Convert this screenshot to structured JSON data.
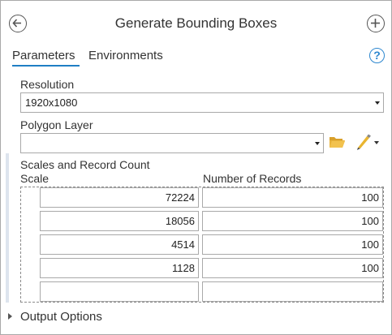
{
  "header": {
    "title": "Generate Bounding Boxes",
    "back_icon": "back-arrow-circle-icon",
    "add_icon": "add-circle-icon"
  },
  "tabs": [
    {
      "label": "Parameters",
      "active": true
    },
    {
      "label": "Environments",
      "active": false
    }
  ],
  "help": {
    "glyph": "?"
  },
  "resolution": {
    "label": "Resolution",
    "value": "1920x1080"
  },
  "polygon_layer": {
    "label": "Polygon Layer",
    "value": ""
  },
  "scales_table": {
    "label": "Scales and Record Count",
    "columns": [
      "Scale",
      "Number of Records"
    ],
    "rows": [
      {
        "scale": "72224",
        "records": "100"
      },
      {
        "scale": "18056",
        "records": "100"
      },
      {
        "scale": "4514",
        "records": "100"
      },
      {
        "scale": "1128",
        "records": "100"
      },
      {
        "scale": "",
        "records": ""
      }
    ]
  },
  "output_options": {
    "label": "Output Options"
  },
  "colors": {
    "accent_blue": "#1f7ec4",
    "folder_yellow": "#e8b33c",
    "pencil_yellow": "#e9b530"
  }
}
